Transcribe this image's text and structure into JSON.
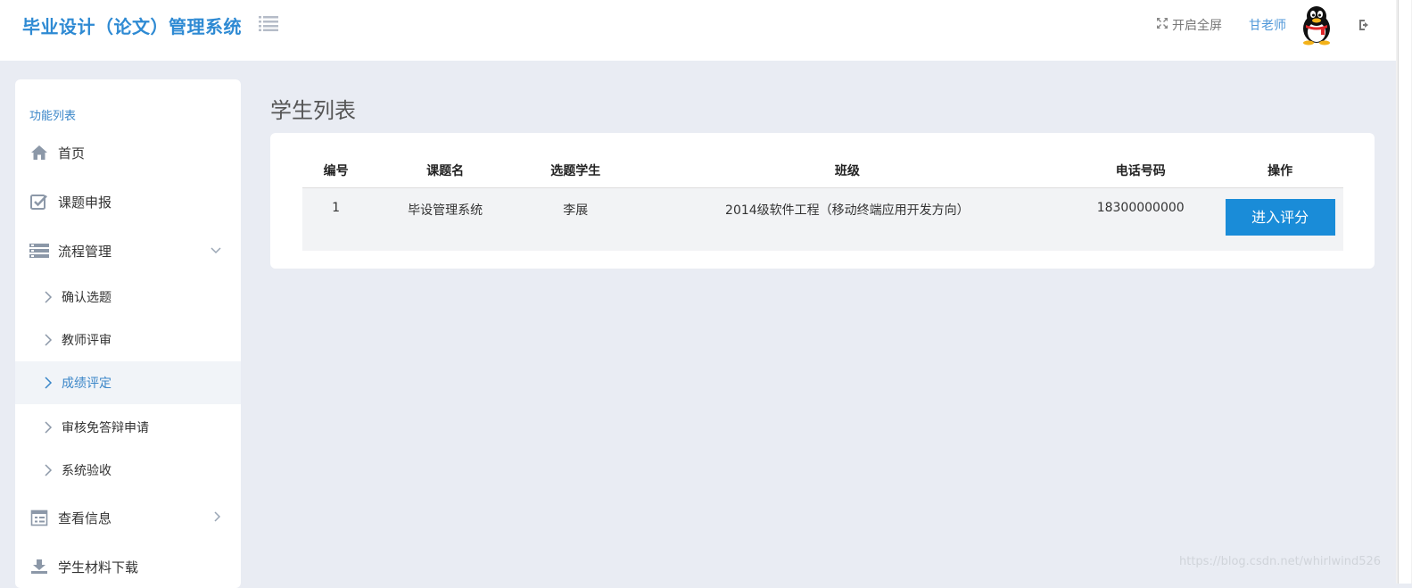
{
  "app": {
    "title": "毕业设计（论文）管理系统"
  },
  "header": {
    "fullscreen_label": "开启全屏",
    "user_name": "甘老师",
    "icons": [
      "menu-list-icon",
      "expand-icon",
      "qq-penguin-avatar",
      "logout-icon"
    ]
  },
  "sidebar": {
    "heading": "功能列表",
    "items": [
      {
        "label": "首页",
        "icon": "home-icon"
      },
      {
        "label": "课题申报",
        "icon": "check-square-icon"
      },
      {
        "label": "流程管理",
        "icon": "list-icon",
        "expanded": true,
        "children": [
          {
            "label": "确认选题"
          },
          {
            "label": "教师评审"
          },
          {
            "label": "成绩评定",
            "active": true
          },
          {
            "label": "审核免答辩申请"
          },
          {
            "label": "系统验收"
          }
        ]
      },
      {
        "label": "查看信息",
        "icon": "calendar-icon"
      },
      {
        "label": "学生材料下载",
        "icon": "download-icon"
      }
    ]
  },
  "main": {
    "title": "学生列表",
    "table": {
      "headers": [
        "编号",
        "课题名",
        "选题学生",
        "班级",
        "电话号码",
        "操作"
      ],
      "rows": [
        {
          "id": "1",
          "topic": "毕设管理系统",
          "student": "李展",
          "class": "2014级软件工程（移动终端应用开发方向）",
          "phone": "18300000000",
          "action": "进入评分"
        }
      ]
    }
  },
  "watermark": "https://blog.csdn.net/whirlwind526",
  "colors": {
    "accent": "#1a8cd8",
    "title": "#2e8ad3",
    "background": "#e9ecf3"
  }
}
